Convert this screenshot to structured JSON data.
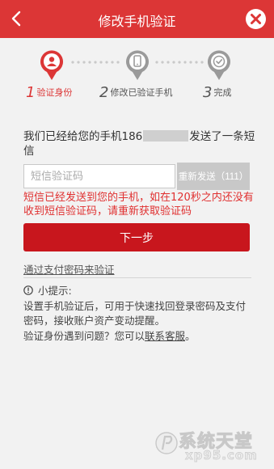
{
  "header": {
    "title": "修改手机验证",
    "back_icon": "chevron-left-icon",
    "close_icon": "close-circle-icon",
    "bg_color": "#dc3636"
  },
  "steps": [
    {
      "num": "1",
      "label": "验证身份",
      "icon": "user-icon",
      "state": "active"
    },
    {
      "num": "2",
      "label": "修改已验证手机",
      "icon": "phone-icon",
      "state": "inactive"
    },
    {
      "num": "3",
      "label": "完成",
      "icon": "check-icon",
      "state": "inactive"
    }
  ],
  "notice": {
    "before": "我们已经给您的手机186",
    "after": "发送了一条短信"
  },
  "code_input": {
    "placeholder": "短信验证码",
    "value": ""
  },
  "resend_button": {
    "label": "重新发送（111）",
    "countdown": 111
  },
  "warning": "短信已经发送到您的手机，如在120秒之内还没有收到短信验证码，请重新获取验证码",
  "next_button": {
    "label": "下一步",
    "color": "#c8161d"
  },
  "alt_link": "通过支付密码来验证",
  "tips": {
    "heading": "小提示:",
    "body": "设置手机验证后，可用于快速找回登录密码及支付密码，接收账户资产变动提醒。",
    "question": "验证身份遇到问题？您可以",
    "contact": "联系客服",
    "end": "。"
  },
  "watermark": {
    "text": "系统天堂",
    "url": "xp95.com"
  }
}
